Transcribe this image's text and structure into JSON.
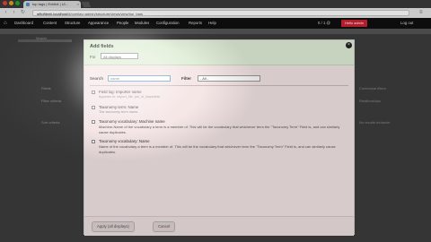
{
  "browser": {
    "tab_title": "top tags | Exhibit | Ul...",
    "url_host": "giftoftjeek.localhost",
    "url_path": "/#/overlay=admin/structure/views/view/top_tags",
    "colors": {
      "tab_active": "#d9d9d9",
      "chrome": "#3a3a3a"
    }
  },
  "admin_toolbar": {
    "items": [
      "Dashboard",
      "Content",
      "Structure",
      "Appearance",
      "People",
      "Modules",
      "Configuration",
      "Reports",
      "Help"
    ],
    "user_greeting": "Hello admin",
    "logout": "Log out",
    "counter": "0 / 1 @"
  },
  "background_page": {
    "labels": [
      "Master",
      "Fields",
      "Filter criteria",
      "Sort criteria",
      "Contextual filters",
      "Relationships",
      "No results behavior"
    ]
  },
  "modal": {
    "title": "Add fields",
    "for_label": "For",
    "for_value": "All displays",
    "close_icon": "close-icon",
    "search_label": "Search",
    "search_value": "name",
    "filter_label": "Filter",
    "filter_value": "- All -",
    "items": [
      {
        "title": "Field log: Importer name",
        "sub": "Appears in: import_file, job_id_importers"
      },
      {
        "title": "Taxonomy term: Name",
        "sub": "The taxonomy term name."
      },
      {
        "title": "Taxonomy vocabulary: Machine name",
        "desc": "Machine-Name of the vocabulary a term is a member of. This will be the vocabulary that whichever term the \"Taxonomy Term\" Field is, and can similarly cause duplicates."
      },
      {
        "title": "Taxonomy vocabulary: Name",
        "desc": "Name of the vocabulary a term is a member of. This will be the vocabulary that whichever term the \"Taxonomy Term\" Field is, and can similarly cause duplicates."
      }
    ],
    "apply_button": "Apply (all displays)",
    "cancel_button": "Cancel",
    "colors": {
      "header_bg": "#e2efd9",
      "body_bg": "#f6e7e7"
    }
  }
}
